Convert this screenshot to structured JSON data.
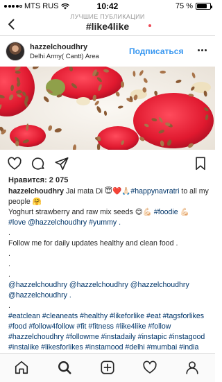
{
  "status_bar": {
    "carrier": "MTS RUS",
    "time": "10:42",
    "battery": "75 %",
    "battery_level": 0.75
  },
  "nav": {
    "subtitle": "ЛУЧШИЕ ПУБЛИКАЦИИ",
    "title": "#like4like"
  },
  "post": {
    "username": "hazzelchoudhry",
    "location": "Delhi Army( Cantt) Area",
    "follow_label": "Подписаться",
    "likes": "Нравится: 2 075",
    "caption_username": "hazzelchoudhry",
    "caption_line1_text": " Jai mata Di 😇❤️🙏🏻",
    "caption_line1_tag": "#happynavratri",
    "caption_line1_tail": " to all my people 🤗",
    "caption_line2_text": "Yoghurt strawberry and raw mix seeds 😊💪🏻 ",
    "caption_line2_tag": "#foodie",
    "caption_line2_tail": " 💪🏻",
    "caption_line3": "#love @hazzelchoudhry #yummy .",
    "dot": ".",
    "follow_line": "Follow me for daily updates healthy and clean food .",
    "mentions": "@hazzelchoudhry @hazzelchoudhry @hazzelchoudhry @hazzelchoudhry .",
    "hashtags": "#eatclean #cleaneats #healthy #likeforlike #eat #tagsforlikes #food #follow4follow #fit #fitness #like4like #follow #hazzelchoudhry #followme #instadaily #instapic #instagood #instalike #likesforlikes #instamood #delhi #mumbai #india #aesthetics"
  },
  "tabbar": {
    "items": [
      "home-icon",
      "search-icon",
      "add-icon",
      "heart-icon",
      "profile-icon"
    ]
  }
}
